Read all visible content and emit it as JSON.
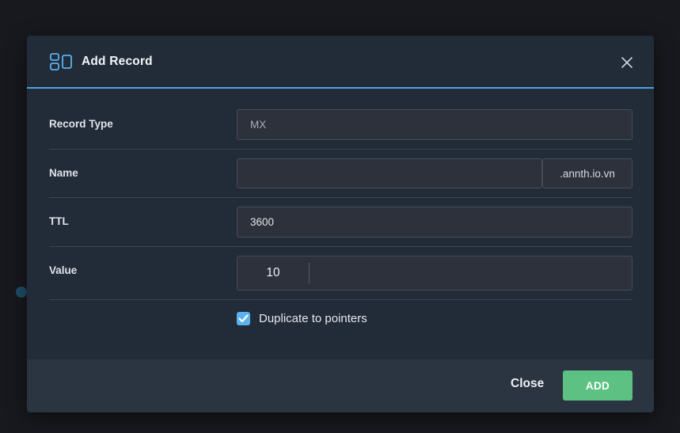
{
  "modal": {
    "title": "Add Record",
    "accent_color": "#4aa3df",
    "header_icon": "record-layout-icon",
    "close_icon": "close-icon"
  },
  "form": {
    "record_type": {
      "label": "Record Type",
      "value": "MX"
    },
    "name": {
      "label": "Name",
      "value": "",
      "suffix": ".annth.io.vn"
    },
    "ttl": {
      "label": "TTL",
      "value": "3600"
    },
    "value": {
      "label": "Value",
      "priority": "10",
      "value": ""
    },
    "duplicate": {
      "label": "Duplicate to pointers",
      "checked": true
    }
  },
  "footer": {
    "close_label": "Close",
    "add_label": "ADD",
    "add_color": "#5cc182"
  }
}
